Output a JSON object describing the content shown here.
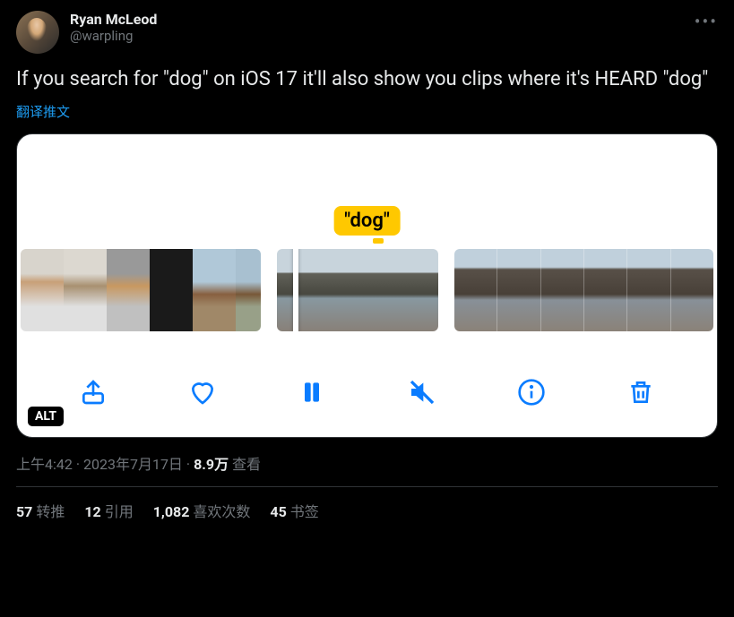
{
  "author": {
    "display_name": "Ryan McLeod",
    "handle": "@warpling"
  },
  "tweet_text": "If you search for \"dog\" on iOS 17 it'll also show you clips where it's HEARD \"dog\"",
  "translate_label": "翻译推文",
  "media": {
    "tooltip_text": "\"dog\"",
    "alt_badge": "ALT",
    "controls": {
      "share": "share",
      "like": "like",
      "pause": "pause",
      "mute": "mute",
      "info": "info",
      "trash": "trash"
    }
  },
  "meta": {
    "time": "上午4:42",
    "date": "2023年7月17日",
    "views_count": "8.9万",
    "views_label": "查看"
  },
  "stats": {
    "retweets_count": "57",
    "retweets_label": "转推",
    "quotes_count": "12",
    "quotes_label": "引用",
    "likes_count": "1,082",
    "likes_label": "喜欢次数",
    "bookmarks_count": "45",
    "bookmarks_label": "书签"
  }
}
